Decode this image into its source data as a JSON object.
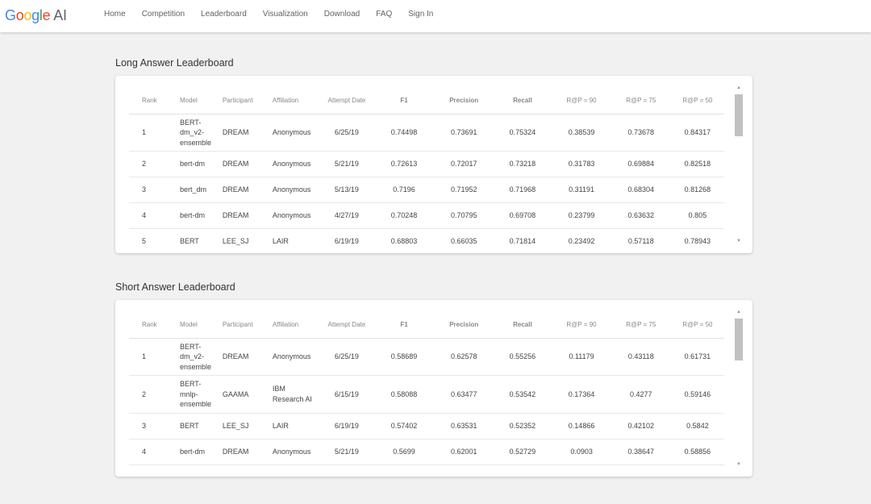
{
  "header": {
    "logo_google": "Google",
    "logo_ai": "AI",
    "nav": [
      "Home",
      "Competition",
      "Leaderboard",
      "Visualization",
      "Download",
      "FAQ",
      "Sign In"
    ]
  },
  "columns": [
    "Rank",
    "Model",
    "Participant",
    "Affiliation",
    "Attempt Date",
    "F1",
    "Precision",
    "Recall",
    "R@P = 90",
    "R@P = 75",
    "R@P = 50"
  ],
  "long": {
    "title": "Long Answer Leaderboard",
    "rows": [
      [
        "1",
        "BERT-dm_v2-ensemble",
        "DREAM",
        "Anonymous",
        "6/25/19",
        "0.74498",
        "0.73691",
        "0.75324",
        "0.38539",
        "0.73678",
        "0.84317"
      ],
      [
        "2",
        "bert-dm",
        "DREAM",
        "Anonymous",
        "5/21/19",
        "0.72613",
        "0.72017",
        "0.73218",
        "0.31783",
        "0.69884",
        "0.82518"
      ],
      [
        "3",
        "bert_dm",
        "DREAM",
        "Anonymous",
        "5/13/19",
        "0.7196",
        "0.71952",
        "0.71968",
        "0.31191",
        "0.68304",
        "0.81268"
      ],
      [
        "4",
        "bert-dm",
        "DREAM",
        "Anonymous",
        "4/27/19",
        "0.70248",
        "0.70795",
        "0.69708",
        "0.23799",
        "0.63632",
        "0.805"
      ],
      [
        "5",
        "BERT",
        "LEE_SJ",
        "LAIR",
        "6/19/19",
        "0.68803",
        "0.66035",
        "0.71814",
        "0.23492",
        "0.57118",
        "0.78943"
      ]
    ]
  },
  "short": {
    "title": "Short Answer Leaderboard",
    "rows": [
      [
        "1",
        "BERT-dm_v2-ensemble",
        "DREAM",
        "Anonymous",
        "6/25/19",
        "0.58689",
        "0.62578",
        "0.55256",
        "0.11179",
        "0.43118",
        "0.61731"
      ],
      [
        "2",
        "BERT-mnlp-ensemble",
        "GAAMA",
        "IBM Research AI",
        "6/15/19",
        "0.58088",
        "0.63477",
        "0.53542",
        "0.17364",
        "0.4277",
        "0.59146"
      ],
      [
        "3",
        "BERT",
        "LEE_SJ",
        "LAIR",
        "6/19/19",
        "0.57402",
        "0.63531",
        "0.52352",
        "0.14866",
        "0.42102",
        "0.5842"
      ],
      [
        "4",
        "bert-dm",
        "DREAM",
        "Anonymous",
        "5/21/19",
        "0.5699",
        "0.62001",
        "0.52729",
        "0.0903",
        "0.38647",
        "0.58856"
      ]
    ]
  }
}
